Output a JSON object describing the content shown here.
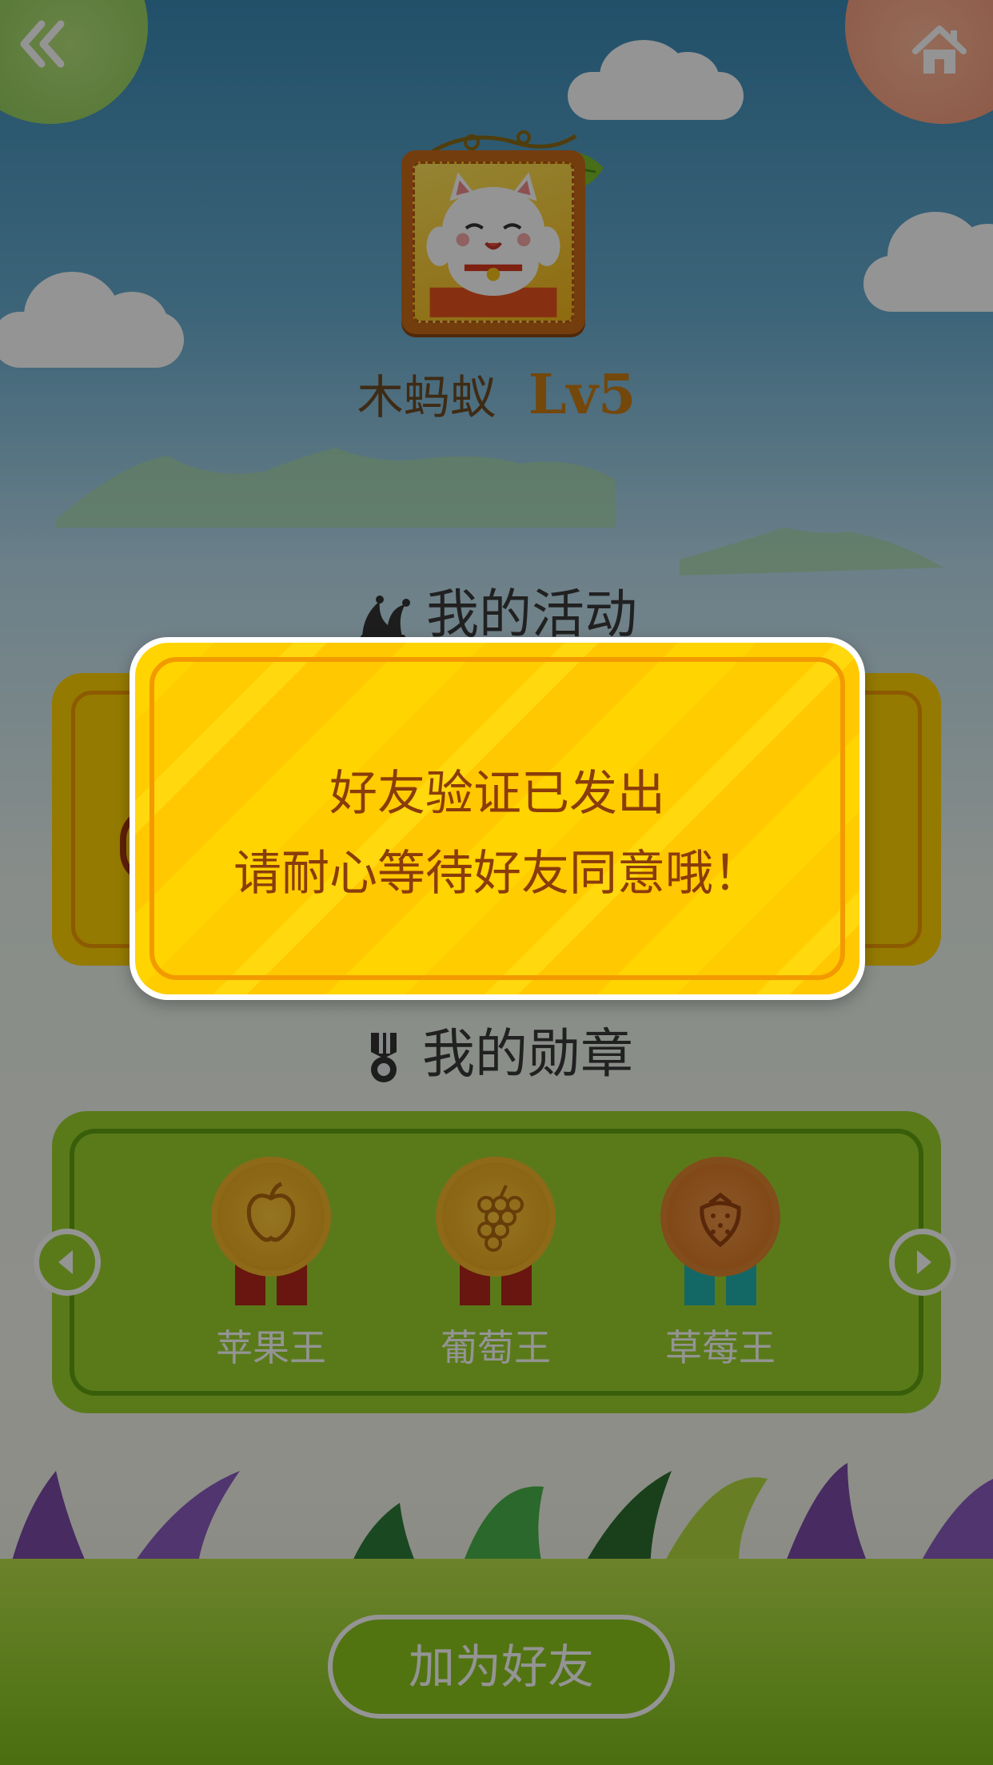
{
  "header": {
    "back_icon": "double-chevron-left-icon",
    "home_icon": "home-icon"
  },
  "profile": {
    "nickname": "木蚂蚁",
    "level": "Lv5",
    "avatar": "lucky-cat-avatar"
  },
  "activities": {
    "title": "我的活动",
    "icon": "jester-hat-icon"
  },
  "badges": {
    "title": "我的勋章",
    "icon": "medal-icon",
    "items": [
      {
        "label": "苹果王",
        "icon": "apple-icon",
        "medal_color": "#e8a318",
        "ribbon_color": "#b3261a"
      },
      {
        "label": "葡萄王",
        "icon": "grape-icon",
        "medal_color": "#e8a318",
        "ribbon_color": "#b3261a"
      },
      {
        "label": "草莓王",
        "icon": "strawberry-icon",
        "medal_color": "#d9731a",
        "ribbon_color": "#22b3b0"
      }
    ]
  },
  "add_friend_button": "加为好友",
  "dialog": {
    "line1": "好友验证已发出",
    "line2": "请耐心等待好友同意哦！"
  },
  "colors": {
    "dialog_fill": "#ffd400",
    "dialog_border": "#f39a00",
    "dialog_text": "#8a3c0a",
    "panel_green": "#9bd22d",
    "level_text": "#c97a14"
  }
}
